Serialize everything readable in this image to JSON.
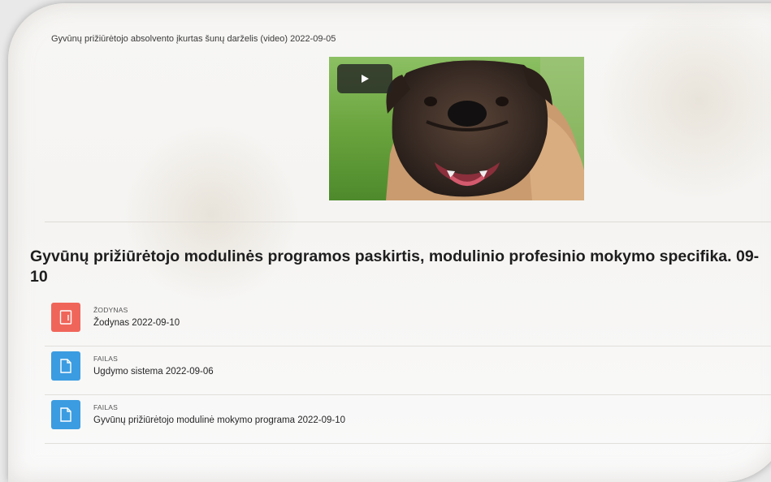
{
  "video": {
    "caption": "Gyvūnų prižiūrėtojo absolvento įkurtas šunų darželis (video) 2022-09-05",
    "play_icon": "play-icon",
    "thumbnail": "bullmastiff-dog-on-grass"
  },
  "section": {
    "title": "Gyvūnų prižiūrėtojo modulinės programos paskirtis, modulinio profesinio mokymo specifika. 09-10"
  },
  "activities": [
    {
      "type": "ŽODYNAS",
      "name": "Žodynas 2022-09-10",
      "icon": "glossary-icon",
      "color": "#f0655a"
    },
    {
      "type": "FAILAS",
      "name": "Ugdymo sistema 2022-09-06",
      "icon": "file-icon",
      "color": "#3b9ce1"
    },
    {
      "type": "FAILAS",
      "name": "Gyvūnų prižiūrėtojo modulinė mokymo programa 2022-09-10",
      "icon": "file-icon",
      "color": "#3b9ce1"
    }
  ]
}
